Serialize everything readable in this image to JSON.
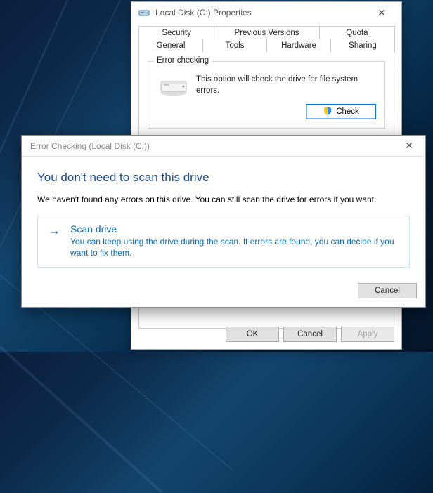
{
  "properties": {
    "title": "Local Disk (C:) Properties",
    "tabs_row1": [
      {
        "label": "Security"
      },
      {
        "label": "Previous Versions"
      },
      {
        "label": "Quota"
      }
    ],
    "tabs_row2": [
      {
        "label": "General"
      },
      {
        "label": "Tools",
        "active": true
      },
      {
        "label": "Hardware"
      },
      {
        "label": "Sharing"
      }
    ],
    "error_checking": {
      "group_title": "Error checking",
      "description": "This option will check the drive for file system errors.",
      "check_button": "Check"
    },
    "buttons": {
      "ok": "OK",
      "cancel": "Cancel",
      "apply": "Apply"
    }
  },
  "dialog": {
    "title": "Error Checking (Local Disk (C:))",
    "heading": "You don't need to scan this drive",
    "subtext": "We haven't found any errors on this drive. You can still scan the drive for errors if you want.",
    "option": {
      "title": "Scan drive",
      "description": "You can keep using the drive during the scan. If errors are found, you can decide if you want to fix them."
    },
    "cancel": "Cancel"
  },
  "icons": {
    "drive": "drive-icon",
    "shield": "shield-icon",
    "close": "close-icon",
    "arrow_right": "arrow-right-icon"
  }
}
